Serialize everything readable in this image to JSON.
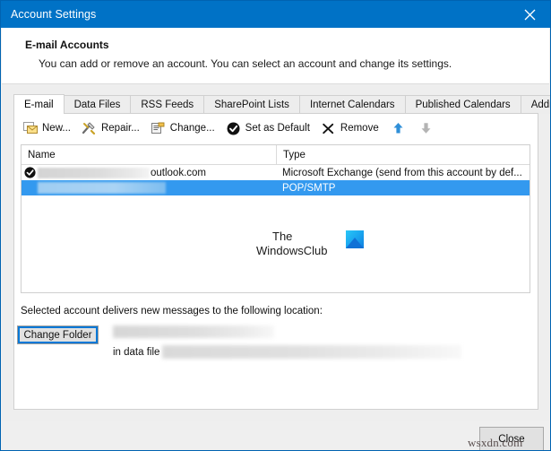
{
  "window": {
    "title": "Account Settings",
    "close_icon": "close-icon",
    "accent_color": "#0072c6"
  },
  "header": {
    "title": "E-mail Accounts",
    "subtitle": "You can add or remove an account. You can select an account and change its settings."
  },
  "tabs": [
    {
      "label": "E-mail",
      "active": true
    },
    {
      "label": "Data Files",
      "active": false
    },
    {
      "label": "RSS Feeds",
      "active": false
    },
    {
      "label": "SharePoint Lists",
      "active": false
    },
    {
      "label": "Internet Calendars",
      "active": false
    },
    {
      "label": "Published Calendars",
      "active": false
    },
    {
      "label": "Address Books",
      "active": false
    }
  ],
  "toolbar": [
    {
      "label": "New...",
      "icon": "new-mail-icon",
      "enabled": true
    },
    {
      "label": "Repair...",
      "icon": "repair-tools-icon",
      "enabled": true
    },
    {
      "label": "Change...",
      "icon": "change-settings-icon",
      "enabled": true
    },
    {
      "label": "Set as Default",
      "icon": "check-circle-icon",
      "enabled": true
    },
    {
      "label": "Remove",
      "icon": "remove-x-icon",
      "enabled": true
    },
    {
      "label": "",
      "icon": "move-up-arrow-icon",
      "enabled": true
    },
    {
      "label": "",
      "icon": "move-down-arrow-icon",
      "enabled": false
    }
  ],
  "account_list": {
    "columns": [
      "Name",
      "Type"
    ],
    "rows": [
      {
        "is_default": true,
        "name_redacted": true,
        "name_visible_suffix": "outlook.com",
        "type": "Microsoft Exchange (send from this account by def...",
        "selected": false
      },
      {
        "is_default": false,
        "name_redacted": true,
        "name_visible_suffix": "",
        "type": "POP/SMTP",
        "selected": true
      }
    ]
  },
  "watermark": {
    "line1": "The",
    "line2": "WindowsClub",
    "logo_icon": "windowsclub-logo-icon",
    "logo_color": "#1ba9f0"
  },
  "delivery": {
    "label": "Selected account delivers new messages to the following location:",
    "change_folder_label": "Change Folder",
    "folder_path_redacted": true,
    "in_data_file_label": "in data file",
    "data_file_redacted": true
  },
  "footer": {
    "close_label": "Close"
  },
  "page_watermark": {
    "text": "wsxdn.com"
  }
}
